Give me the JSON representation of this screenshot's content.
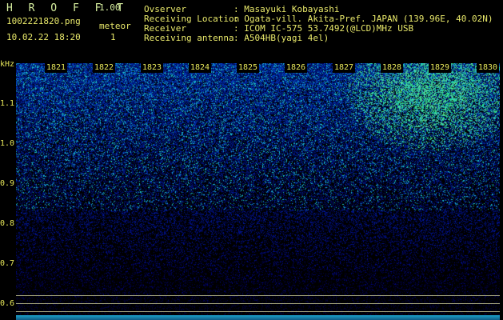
{
  "header": {
    "app_title": "H R O F F T",
    "version": "1.00",
    "filename": "1002221820.png",
    "datetime": "10.02.22 18:20",
    "meteor_label": "meteor",
    "meteor_count": "1"
  },
  "info": {
    "observer_label": "Ovserver",
    "observer_value": ": Masayuki Kobayashi",
    "location_label": "Receiving Location",
    "location_value": ": Ogata-vill. Akita-Pref. JAPAN (139.96E, 40.02N)",
    "receiver_label": "Receiver",
    "receiver_value": ": ICOM IC-575 53.7492(@LCD)MHz USB",
    "antenna_label": "Receiving antenna",
    "antenna_value": ": A504HB(yagi 4el)"
  },
  "axis": {
    "unit": "kHz",
    "ticks": [
      "1.1",
      "1.0",
      "0.9",
      "0.8",
      "0.7",
      "0.6"
    ]
  },
  "minutes": [
    "1821",
    "1822",
    "1823",
    "1824",
    "1825",
    "1826",
    "1827",
    "1828",
    "1829",
    "1830"
  ],
  "colors": {
    "background": "#000000",
    "text": "#e6e65a",
    "spectrum_low": "#0a1450",
    "spectrum_mid": "#1e46c8",
    "spectrum_high": "#28c8a0"
  }
}
